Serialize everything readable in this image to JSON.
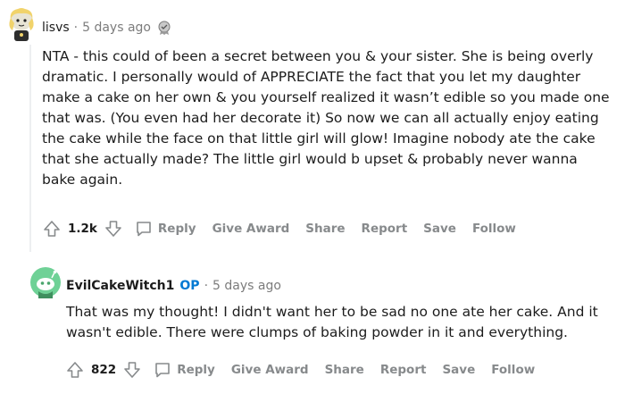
{
  "comments": [
    {
      "author": "lisvs",
      "separator": "·",
      "time": "5 days ago",
      "award_icon": "gold-award-icon",
      "body": "NTA - this could of been a secret between you & your sister. She is being overly dramatic. I personally would of APPRECIATE the fact that you let my daughter make a cake on her own & you yourself realized it wasn’t edible so you made one that was. (You even had her decorate it) So now we can all actually enjoy eating the cake while the face on that little girl will glow! Imagine nobody ate the cake that she actually made? The little girl would b upset & probably never wanna bake again.",
      "score": "1.2k",
      "actions": {
        "reply": "Reply",
        "give_award": "Give Award",
        "share": "Share",
        "report": "Report",
        "save": "Save",
        "follow": "Follow"
      }
    },
    {
      "author": "EvilCakeWitch1",
      "op_badge": "OP",
      "separator": "·",
      "time": "5 days ago",
      "body": "That was my thought! I didn't want her to be sad no one ate her cake. And it wasn't edible. There were clumps of baking powder in it and everything.",
      "score": "822",
      "actions": {
        "reply": "Reply",
        "give_award": "Give Award",
        "share": "Share",
        "report": "Report",
        "save": "Save",
        "follow": "Follow"
      }
    }
  ],
  "colors": {
    "meta_gray": "#7c7c7c",
    "action_gray": "#878a8c",
    "op_blue": "#0079d3",
    "avatar2_green": "#6fd196",
    "thread_line": "#edeff1"
  }
}
